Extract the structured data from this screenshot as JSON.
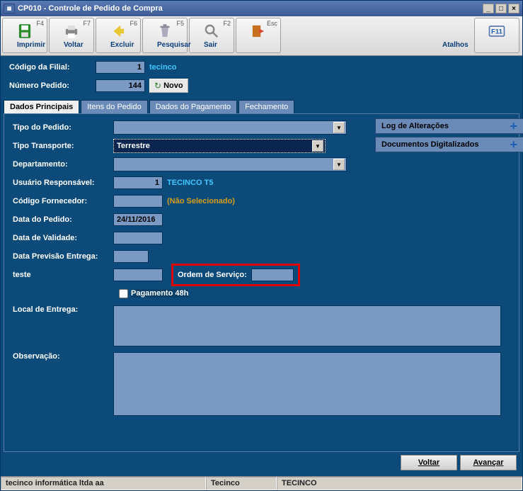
{
  "window": {
    "title": "CP010 - Controle de Pedido de Compra"
  },
  "toolbar": {
    "gravar": {
      "label": "Gravar",
      "key": "F4"
    },
    "imprimir": {
      "label": "Imprimir",
      "key": "F7"
    },
    "voltar": {
      "label": "Voltar",
      "key": "F6"
    },
    "excluir": {
      "label": "Excluir",
      "key": "F5"
    },
    "pesquisar": {
      "label": "Pesquisar",
      "key": "F2"
    },
    "sair": {
      "label": "Sair",
      "key": "Esc"
    },
    "atalhos": {
      "label": "Atalhos",
      "key": "F11"
    }
  },
  "header": {
    "filial_label": "Código da Filial:",
    "filial_value": "1",
    "filial_name": "tecinco",
    "pedido_label": "Número Pedido:",
    "pedido_value": "144",
    "novo_label": "Novo"
  },
  "tabs": {
    "principais": "Dados Principais",
    "itens": "Itens do Pedido",
    "pagamento": "Dados do Pagamento",
    "fechamento": "Fechamento"
  },
  "form": {
    "tipo_pedido_label": "Tipo do Pedido:",
    "tipo_pedido_value": "",
    "tipo_transporte_label": "Tipo Transporte:",
    "tipo_transporte_value": "Terrestre",
    "departamento_label": "Departamento:",
    "departamento_value": "",
    "usuario_label": "Usuário Responsável:",
    "usuario_value": "1",
    "usuario_name": "TECINCO T5",
    "fornecedor_label": "Código Fornecedor:",
    "fornecedor_value": "",
    "fornecedor_name": "(Não Selecionado)",
    "data_pedido_label": "Data do Pedido:",
    "data_pedido_value": "24/11/2016",
    "data_validade_label": "Data de Validade:",
    "data_validade_value": "",
    "data_previsao_label": "Data Previsão Entrega:",
    "data_previsao_value": "",
    "teste_label": "teste",
    "teste_value": "",
    "ordem_servico_label": "Ordem de Serviço:",
    "ordem_servico_value": "",
    "pagamento48h_label": "Pagamento 48h",
    "local_entrega_label": "Local de Entrega:",
    "local_entrega_value": "",
    "observacao_label": "Observação:",
    "observacao_value": ""
  },
  "side": {
    "log": "Log de Alterações",
    "docs": "Documentos Digitalizados"
  },
  "bottom": {
    "voltar": "Voltar",
    "avancar": "Avançar"
  },
  "status": {
    "company": "tecinco informática ltda aa",
    "name1": "Tecinco",
    "name2": "TECINCO"
  }
}
